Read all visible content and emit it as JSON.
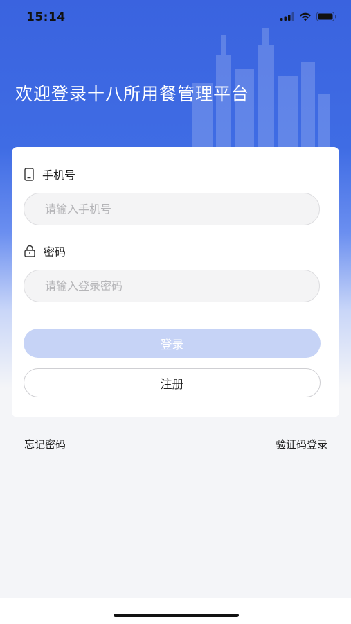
{
  "status_bar": {
    "time": "15:14",
    "icons": [
      "signal-icon",
      "wifi-icon",
      "battery-icon"
    ]
  },
  "header": {
    "title": "欢迎登录十八所用餐管理平台"
  },
  "form": {
    "phone": {
      "label": "手机号",
      "icon": "phone-icon",
      "placeholder": "请输入手机号",
      "value": ""
    },
    "password": {
      "label": "密码",
      "icon": "lock-icon",
      "placeholder": "请输入登录密码",
      "value": ""
    },
    "login_label": "登录",
    "register_label": "注册"
  },
  "links": {
    "forgot_password": "忘记密码",
    "sms_login": "验证码登录"
  },
  "colors": {
    "brand_blue": "#3a63df",
    "login_button_disabled": "#c6d3f6",
    "page_background": "#f4f5f8"
  }
}
